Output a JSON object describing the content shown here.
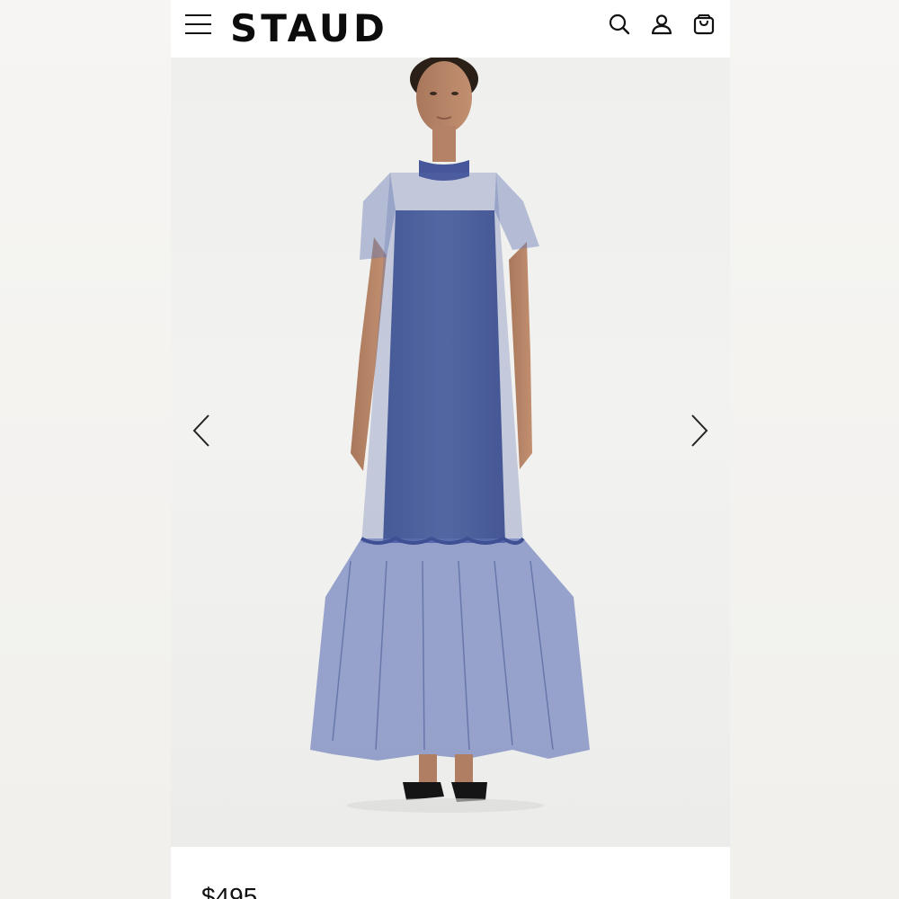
{
  "brand": {
    "logo_text": "STAUD"
  },
  "header": {
    "icons": [
      "menu-icon",
      "search-icon",
      "account-icon",
      "shopping-bag-icon"
    ]
  },
  "gallery": {
    "prev_icon": "chevron-left-icon",
    "next_icon": "chevron-right-icon"
  },
  "product": {
    "price": "$495"
  },
  "colors": {
    "dress": "#4b5f9e",
    "background": "#f2f2f0",
    "text": "#111111"
  }
}
